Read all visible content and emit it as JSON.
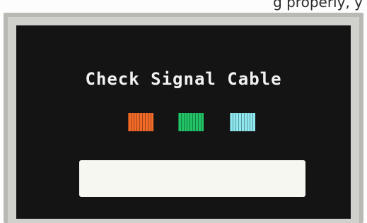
{
  "top_text": "g properly, y",
  "screen": {
    "message": "Check Signal Cable"
  },
  "swatches": [
    {
      "name": "red",
      "color": "#f26a28"
    },
    {
      "name": "green",
      "color": "#22c266"
    },
    {
      "name": "cyan",
      "color": "#8fe8f0"
    }
  ],
  "colors": {
    "screen_background": "#141414",
    "bezel": "#c7c7c2",
    "bar": "#f7f7f1"
  }
}
